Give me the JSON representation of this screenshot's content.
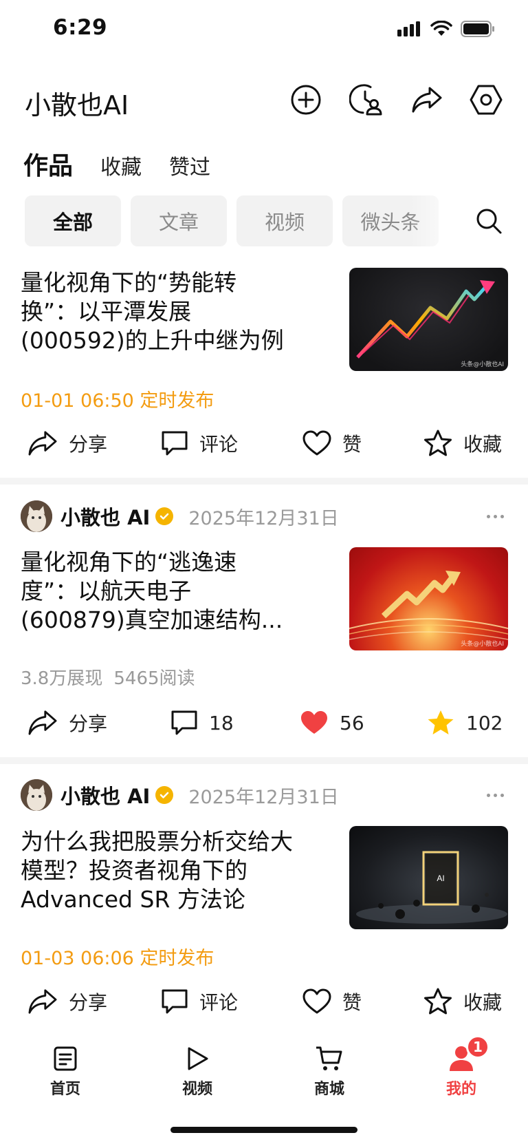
{
  "status_bar": {
    "time": "6:29"
  },
  "header": {
    "profile_name": "小散也AI"
  },
  "section_tabs": [
    "作品",
    "收藏",
    "赞过"
  ],
  "filters": [
    "全部",
    "文章",
    "视频",
    "微头条"
  ],
  "colors": {
    "accent": "#f04142",
    "scheduled": "#f39c12",
    "star": "#ffc300",
    "verified": "#f5b400"
  },
  "posts": [
    {
      "title": "量化视角下的“势能转换”：以平潭发展(000592)的上升中继为例",
      "title_lines": [
        "量化视角下的“势能转",
        "换”：以平潭发展",
        "(000592)的上升中继为例"
      ],
      "scheduled": "01-01 06:50 定时发布",
      "thumb_watermark": "头条@小散也AI",
      "actions": {
        "share": "分享",
        "comment": "评论",
        "like": "赞",
        "favorite": "收藏"
      }
    },
    {
      "author": "小散也 AI",
      "date": "2025年12月31日",
      "title_lines": [
        "量化视角下的“逃逸速",
        "度”：以航天电子",
        "(600879)真空加速结构..."
      ],
      "impressions": "3.8万展现",
      "reads": "5465阅读",
      "thumb_watermark": "头条@小散也AI",
      "actions": {
        "share": "分享",
        "comment": "18",
        "like": "56",
        "favorite": "102"
      }
    },
    {
      "author": "小散也 AI",
      "date": "2025年12月31日",
      "title_lines": [
        "为什么我把股票分析交给大",
        "模型？投资者视角下的",
        "Advanced SR 方法论"
      ],
      "thumb_text": "AI",
      "scheduled": "01-03 06:06 定时发布",
      "actions": {
        "share": "分享",
        "comment": "评论",
        "like": "赞",
        "favorite": "收藏"
      }
    }
  ],
  "tabbar": {
    "items": [
      {
        "label": "首页",
        "icon": "document-icon"
      },
      {
        "label": "视频",
        "icon": "play-icon"
      },
      {
        "label": "商城",
        "icon": "cart-icon"
      },
      {
        "label": "我的",
        "icon": "person-icon",
        "badge": "1"
      }
    ]
  }
}
